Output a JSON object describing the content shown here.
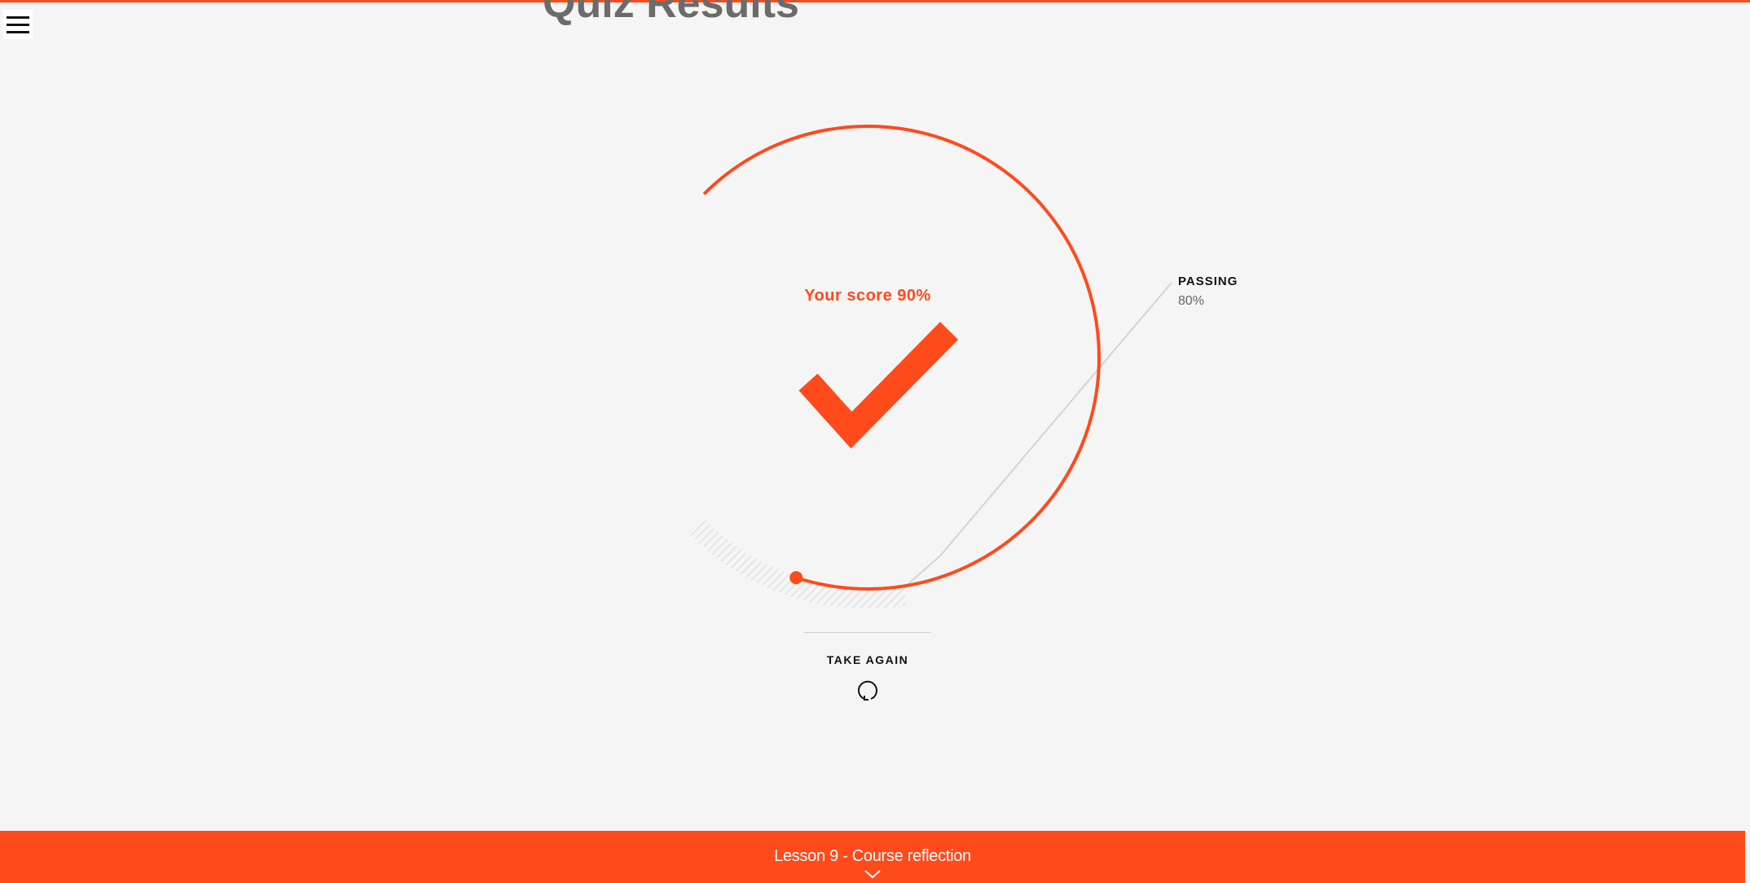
{
  "page": {
    "title": "Quiz Results"
  },
  "menu": {
    "icon": "hamburger-menu-icon"
  },
  "result": {
    "score_text": "Your score 90%",
    "score_percent": 90,
    "passed": true,
    "status_icon": "checkmark-icon",
    "passing_label": "PASSING",
    "passing_value": "80%",
    "passing_percent": 80
  },
  "actions": {
    "take_again_label": "TAKE AGAIN",
    "take_again_icon": "retry-icon"
  },
  "footer": {
    "next_lesson_label": "Lesson 9 - Course reflection",
    "next_icon": "chevron-down-icon"
  },
  "colors": {
    "accent": "#ff4a1c",
    "background": "#f5f5f5",
    "hatch": "#d8d8d8"
  }
}
